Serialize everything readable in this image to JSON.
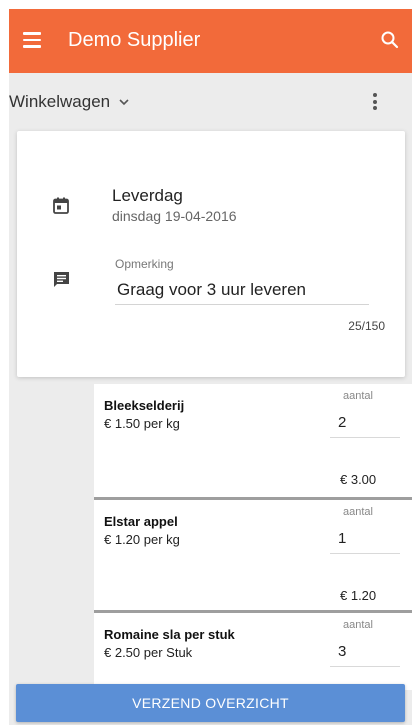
{
  "app_bar": {
    "title": "Demo Supplier",
    "menu_icon": "hamburger-menu-icon",
    "search_icon": "search-icon",
    "color": "#f26a3a"
  },
  "subbar": {
    "title": "Winkelwagen",
    "dropdown_icon": "chevron-down-icon",
    "more_icon": "more-vert-icon"
  },
  "delivery": {
    "date_icon": "calendar-icon",
    "date_label": "Leverdag",
    "date_value": "dinsdag 19-04-2016",
    "comment_icon": "comment-icon",
    "comment_label": "Opmerking",
    "comment_value": "Graag voor 3 uur leveren",
    "comment_counter": "25/150"
  },
  "products": [
    {
      "name": "Bleekselderij",
      "price": "€ 1.50 per kg",
      "qty_label": "aantal",
      "qty": "2",
      "total": "€ 3.00"
    },
    {
      "name": "Elstar appel",
      "price": "€ 1.20 per kg",
      "qty_label": "aantal",
      "qty": "1",
      "total": "€ 1.20"
    },
    {
      "name": "Romaine sla per stuk",
      "price": "€ 2.50 per Stuk",
      "qty_label": "aantal",
      "qty": "3",
      "total": ""
    }
  ],
  "submit": {
    "label": "VERZEND OVERZICHT",
    "color": "#5b8fd6"
  }
}
